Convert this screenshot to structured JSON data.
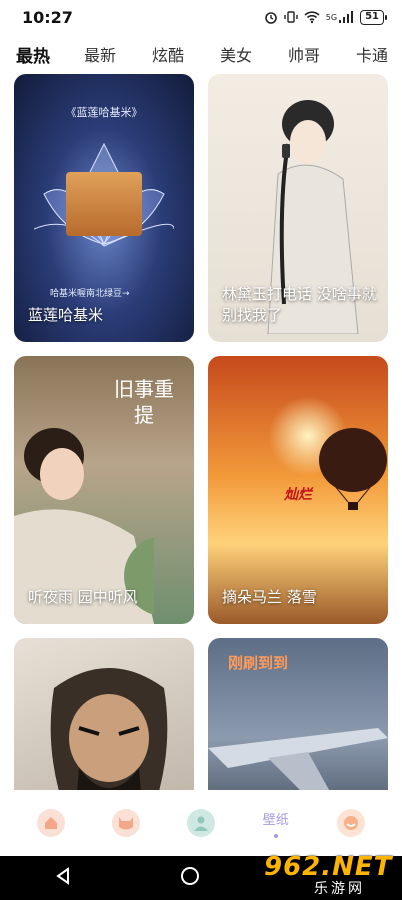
{
  "status": {
    "time": "10:27",
    "battery": "51",
    "network": "5G"
  },
  "tabs": [
    "最热",
    "最新",
    "炫酷",
    "美女",
    "帅哥",
    "卡通"
  ],
  "cards": [
    {
      "caption": "蓝莲哈基米",
      "poster_title": "《蓝莲哈基米》",
      "poster_sub": "哈基米喔南北绿豆→"
    },
    {
      "caption": "林黛玉打电话 没啥事就别找我了"
    },
    {
      "caption": "听夜雨 园中听风",
      "poster_text": "旧事重提"
    },
    {
      "caption": "摘朵马兰 落雪",
      "poster_text": "灿烂"
    },
    {
      "caption": ""
    },
    {
      "caption": "",
      "poster_text": "刚刷到到"
    }
  ],
  "bottom_nav": {
    "items": [
      {
        "icon": "home-icon",
        "color": "#f2a68a"
      },
      {
        "icon": "cat-face-icon",
        "color": "#f2a68a"
      },
      {
        "icon": "avatar-icon",
        "color": "#8fc7b8"
      },
      {
        "label": "壁纸",
        "active": true,
        "color": "#a59be0"
      },
      {
        "icon": "smile-icon",
        "color": "#f7b08a"
      }
    ]
  },
  "watermark": {
    "brand": "962.NET",
    "site": "乐游网"
  }
}
